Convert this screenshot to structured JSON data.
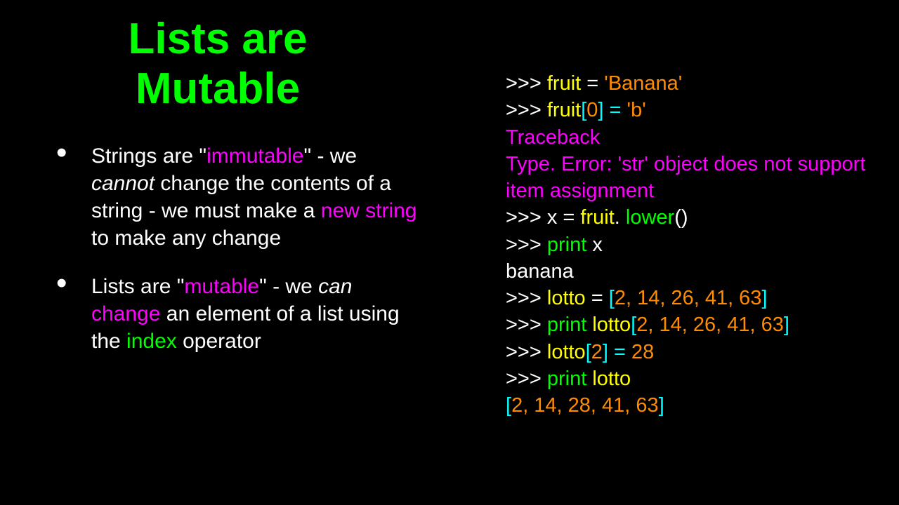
{
  "title": "Lists are Mutable",
  "bullet1": {
    "p1": "Strings are \"",
    "p2": "immutable",
    "p3": "\" - we ",
    "p4": "cannot",
    "p5": " change the contents of a string - we must make a ",
    "p6": "new string",
    "p7": " to make any change"
  },
  "bullet2": {
    "p1": "Lists are \"",
    "p2": "mutable",
    "p3": "\" - we ",
    "p4": "can",
    "p5": " ",
    "p6": "change",
    "p7": " an element of a list using the ",
    "p8": "index",
    "p9": " operator"
  },
  "code": {
    "l1a": ">>> ",
    "l1b": "fruit",
    "l1c": " = ",
    "l1d": "'Banana'",
    "l2a": ">>> ",
    "l2b": "fruit",
    "l2c": "[",
    "l2d": "0",
    "l2e": "] = ",
    "l2f": "'b'",
    "l3": "Traceback",
    "l4": "Type. Error: 'str' object does not support item assignment",
    "l5a": ">>> x = ",
    "l5b": "fruit",
    "l5c": ". ",
    "l5d": "lower",
    "l5e": "()",
    "l6a": ">>> ",
    "l6b": "print",
    "l6c": " x",
    "l7": "banana",
    "l8a": ">>> ",
    "l8b": "lotto",
    "l8c": " = ",
    "l8d": "[",
    "l8e": "2, 14, 26, 41, 63",
    "l8f": "]",
    "l9a": ">>> ",
    "l9b": "print",
    "l9c": " ",
    "l9d": "lotto",
    "l9e": "[",
    "l9f": "2, 14, 26, 41, 63",
    "l9g": "]",
    "l10a": ">>> ",
    "l10b": "lotto",
    "l10c": "[",
    "l10d": "2",
    "l10e": "] = ",
    "l10f": "28",
    "l11a": ">>> ",
    "l11b": "print",
    "l11c": " ",
    "l11d": "lotto",
    "l12a": "[",
    "l12b": "2, 14, 28, 41, 63",
    "l12c": "]"
  }
}
